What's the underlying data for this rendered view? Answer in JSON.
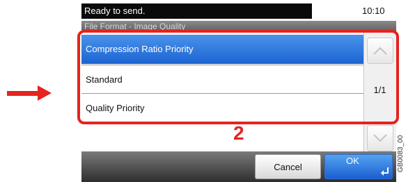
{
  "status": {
    "message": "Ready to send.",
    "time": "10:10"
  },
  "screen_title": "File Format - Image Quality",
  "options": [
    {
      "label": "Compression Ratio Priority",
      "selected": true
    },
    {
      "label": "Standard",
      "selected": false
    },
    {
      "label": "Quality Priority",
      "selected": false
    }
  ],
  "pager": {
    "indicator": "1/1"
  },
  "annotation": {
    "step": "2"
  },
  "buttons": {
    "cancel": "Cancel",
    "ok": "OK"
  },
  "figure_code": "GB0083_00",
  "icons": {
    "pointer": "right-arrow-icon",
    "scroll_up": "chevron-up-icon",
    "scroll_down": "chevron-down-icon",
    "ok": "enter-icon"
  },
  "colors": {
    "accent_red": "#e52320",
    "selection_blue": "#1c63d2"
  }
}
